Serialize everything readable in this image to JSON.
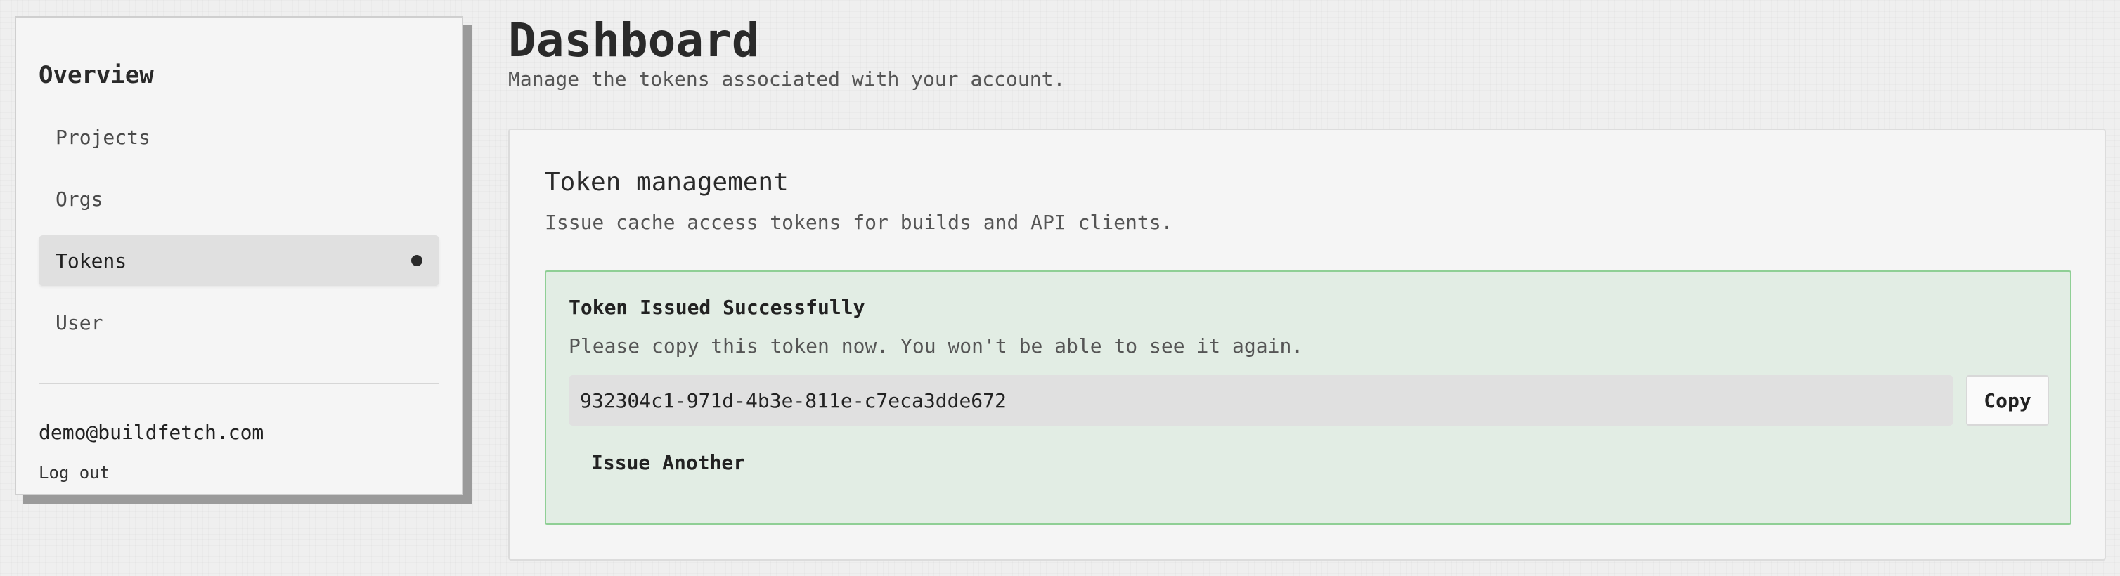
{
  "sidebar": {
    "title": "Overview",
    "items": [
      {
        "label": "Projects",
        "active": false
      },
      {
        "label": "Orgs",
        "active": false
      },
      {
        "label": "Tokens",
        "active": true
      },
      {
        "label": "User",
        "active": false
      }
    ],
    "user_email": "demo@buildfetch.com",
    "logout_label": "Log out"
  },
  "header": {
    "title": "Dashboard",
    "subtitle": "Manage the tokens associated with your account."
  },
  "card": {
    "title": "Token management",
    "description": "Issue cache access tokens for builds and API clients.",
    "alert": {
      "title": "Token Issued Successfully",
      "message": "Please copy this token now. You won't be able to see it again.",
      "token_value": "932304c1-971d-4b3e-811e-c7eca3dde672",
      "copy_label": "Copy",
      "issue_another_label": "Issue Another"
    }
  },
  "colors": {
    "success_background": "#e2ede4",
    "success_border": "#8fcf95",
    "active_nav_background": "#e0e0e0"
  },
  "icons": {
    "active_indicator": "active-dot-icon"
  }
}
